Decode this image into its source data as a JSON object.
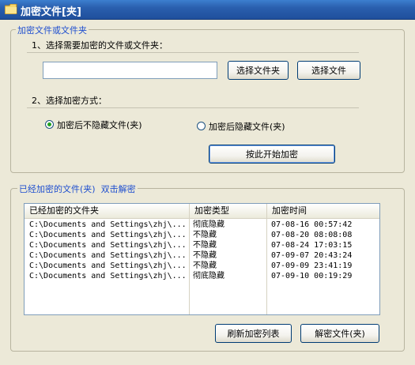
{
  "window": {
    "title": "加密文件[夹]"
  },
  "encrypt_group": {
    "legend": "加密文件或文件夹",
    "step1_label": "1、选择需要加密的文件或文件夹：",
    "path_value": "",
    "btn_choose_folder": "选择文件夹",
    "btn_choose_file": "选择文件",
    "step2_label": "2、选择加密方式：",
    "radio_no_hide": "加密后不隐藏文件(夹)",
    "radio_hide": "加密后隐藏文件(夹)",
    "selected_mode": "no_hide",
    "btn_start": "按此开始加密"
  },
  "encrypted_group": {
    "legend": "已经加密的文件(夹)  双击解密",
    "columns": [
      "已经加密的文件夹",
      "加密类型",
      "加密时间"
    ],
    "rows": [
      {
        "path": "C:\\Documents and Settings\\zhj\\...",
        "type": "彻底隐藏",
        "time": "07-08-16 00:57:42"
      },
      {
        "path": "C:\\Documents and Settings\\zhj\\...",
        "type": "不隐藏",
        "time": "07-08-20 08:08:08"
      },
      {
        "path": "C:\\Documents and Settings\\zhj\\...",
        "type": "不隐藏",
        "time": "07-08-24 17:03:15"
      },
      {
        "path": "C:\\Documents and Settings\\zhj\\...",
        "type": "不隐藏",
        "time": "07-09-07 20:43:24"
      },
      {
        "path": "C:\\Documents and Settings\\zhj\\...",
        "type": "不隐藏",
        "time": "07-09-09 23:41:19"
      },
      {
        "path": "C:\\Documents and Settings\\zhj\\...",
        "type": "彻底隐藏",
        "time": "07-09-10 00:19:29"
      }
    ],
    "btn_refresh": "刷新加密列表",
    "btn_decrypt": "解密文件(夹)"
  }
}
